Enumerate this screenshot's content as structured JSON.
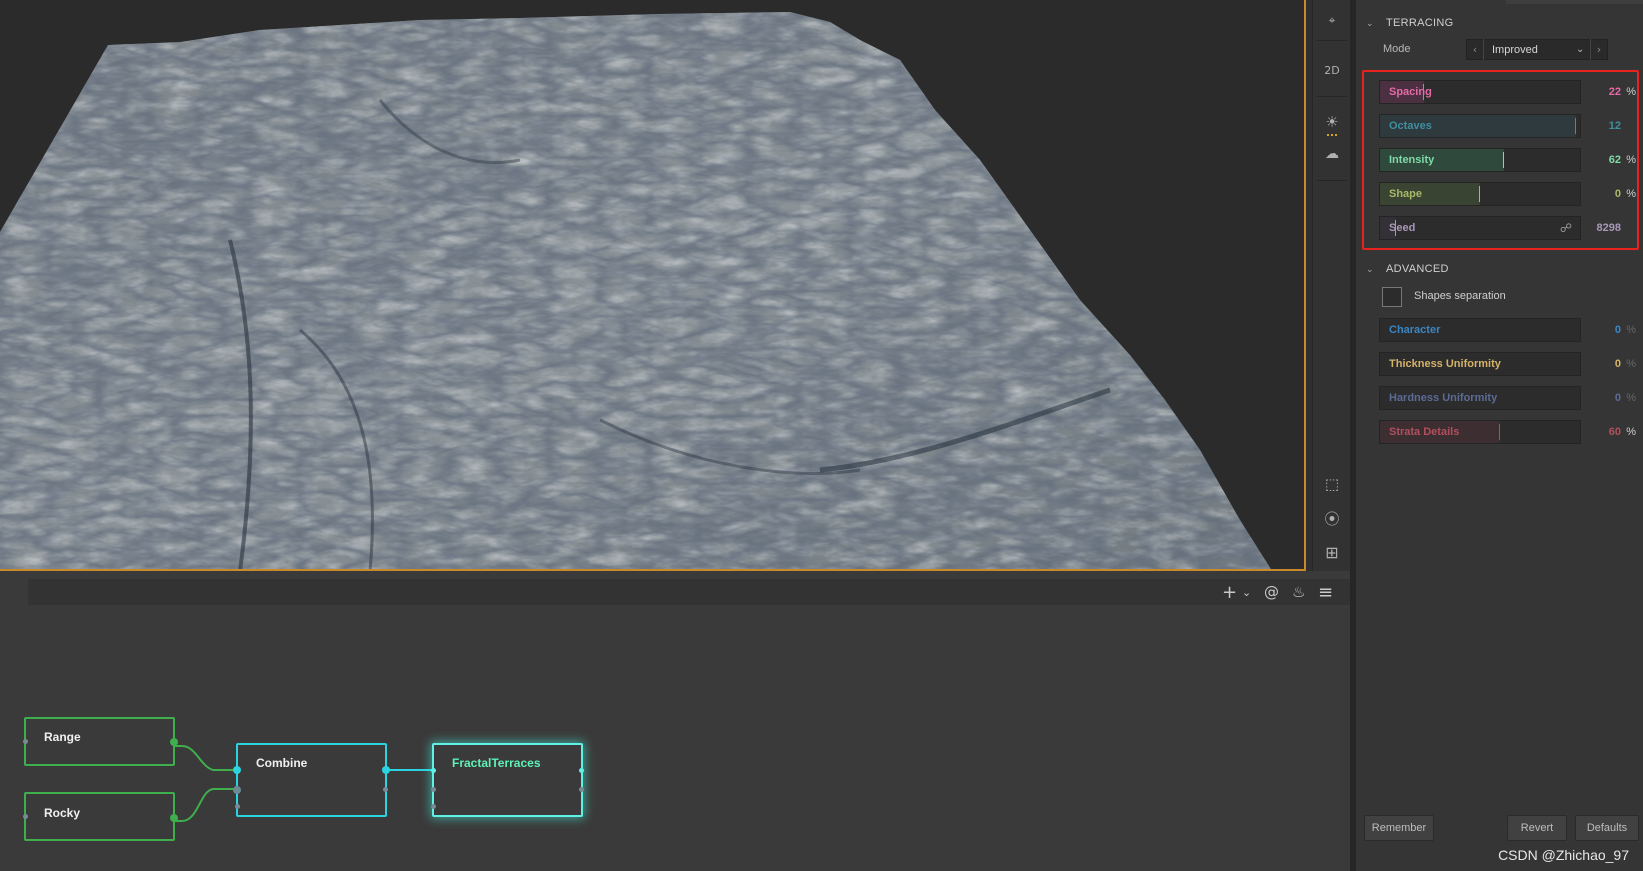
{
  "viewport": {
    "toolbar": [
      {
        "name": "map-pin-icon",
        "label": "⌖"
      },
      {
        "name": "view-2d-button",
        "label": "2D"
      },
      {
        "name": "sun-icon",
        "label": "☀"
      },
      {
        "name": "cloud-icon",
        "label": "☁"
      },
      {
        "name": "frame-icon",
        "label": "⬚"
      },
      {
        "name": "compass-icon",
        "label": "⦿"
      },
      {
        "name": "grid-icon",
        "label": "⊞"
      }
    ]
  },
  "graph": {
    "toolbar": {
      "add": "+",
      "dropdown": "⌄",
      "at": "@",
      "flame": "♨",
      "menu": "≡"
    },
    "nodes": {
      "range": "Range",
      "rocky": "Rocky",
      "combine": "Combine",
      "fractal": "FractalTerraces"
    }
  },
  "panel": {
    "terracing": {
      "title": "TERRACING",
      "mode_label": "Mode",
      "mode_value": "Improved",
      "sliders": [
        {
          "label": "Spacing",
          "value": "22",
          "unit": "%",
          "level": 0.22,
          "color": "#e66aa6",
          "fill": "#4a3040"
        },
        {
          "label": "Octaves",
          "value": "12",
          "unit": "",
          "level": 0.98,
          "color": "#3f8fa0",
          "fill": "#2e3a3d"
        },
        {
          "label": "Intensity",
          "value": "62",
          "unit": "%",
          "level": 0.62,
          "color": "#7fd9a8",
          "fill": "#2f4a3c"
        },
        {
          "label": "Shape",
          "value": "0",
          "unit": "%",
          "level": 0.5,
          "color": "#a8b96a",
          "fill": "#3a4432"
        },
        {
          "label": "Seed",
          "value": "8298",
          "unit": "",
          "level": 0.08,
          "color": "#a898b8",
          "fill": "#333036"
        }
      ],
      "seed_link_icon": "☍"
    },
    "advanced": {
      "title": "ADVANCED",
      "checkbox_label": "Shapes separation",
      "sliders": [
        {
          "label": "Character",
          "value": "0",
          "unit": "%",
          "level": 0.0,
          "color": "#3a86c4",
          "fill": "#2e3640"
        },
        {
          "label": "Thickness Uniformity",
          "value": "0",
          "unit": "%",
          "level": 0.0,
          "color": "#d4b268",
          "fill": "#3d3a30"
        },
        {
          "label": "Hardness Uniformity",
          "value": "0",
          "unit": "%",
          "level": 0.0,
          "color": "#5c6a96",
          "fill": "#30333d"
        },
        {
          "label": "Strata Details",
          "value": "60",
          "unit": "%",
          "level": 0.6,
          "color": "#b0505e",
          "fill": "#3d2e32"
        }
      ]
    },
    "buttons": {
      "remember": "Remember",
      "revert": "Revert",
      "defaults": "Defaults"
    }
  },
  "watermark": "CSDN @Zhichao_97"
}
